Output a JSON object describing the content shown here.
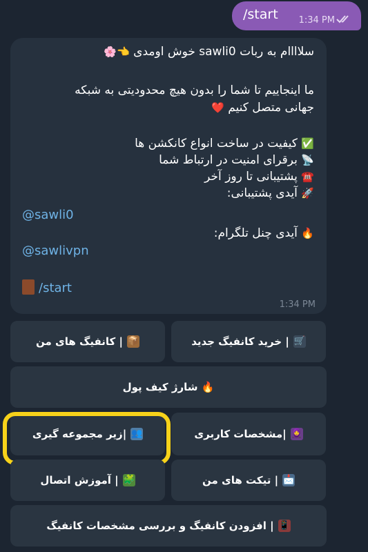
{
  "outgoing": {
    "text": "/start",
    "time": "1:34 PM"
  },
  "incoming": {
    "line1": "سلاااام به ربات sawli0 خوش اومدی",
    "line1_emoji": "👈🌸",
    "line2": "ما اینجاییم تا شما را بدون هیچ محدودیتی به شبکه",
    "line3": "جهانی متصل کنیم",
    "line3_emoji": "❤️",
    "feature1_emoji": "✅",
    "feature1": "کیفیت در ساخت انواع کانکشن ها",
    "feature2_emoji": "📡",
    "feature2": "برقرای امنیت در ارتباط شما",
    "feature3_emoji": "☎️",
    "feature3": "پشتیبانی تا روز آخر",
    "support_emoji": "🚀",
    "support_label": "آیدی پشتیبانی:",
    "support_id": "@sawli0",
    "channel_emoji": "🔥",
    "channel_label": "آیدی چنل تلگرام:",
    "channel_id": "@sawlivpn",
    "start_cmd": "/start",
    "time": "1:34 PM"
  },
  "keyboard": {
    "buy_config": "خرید کانفیگ جدید",
    "buy_config_icon": "🛒",
    "my_configs": "کانفیگ های من",
    "my_configs_icon": "📦",
    "charge_wallet": "شارژ کیف پول",
    "charge_wallet_icon": "🔥",
    "user_info": "مشخصات کاربری",
    "user_info_icon": "🧕",
    "referral": "زیر مجموعه گیری",
    "referral_icon": "👥",
    "my_tickets": "تیکت های من",
    "my_tickets_icon": "📩",
    "connect_tutorial": "آموزش اتصال",
    "connect_tutorial_icon": "🧩",
    "add_config": "افزودن کانفیگ و بررسی مشخصات کانفیگ",
    "add_config_icon": "📱",
    "separator": "|"
  },
  "colors": {
    "outgoing_bubble": "#8a5ab5",
    "incoming_bubble": "#26313e",
    "link": "#6fb3e6",
    "highlight": "#f7d21a"
  }
}
